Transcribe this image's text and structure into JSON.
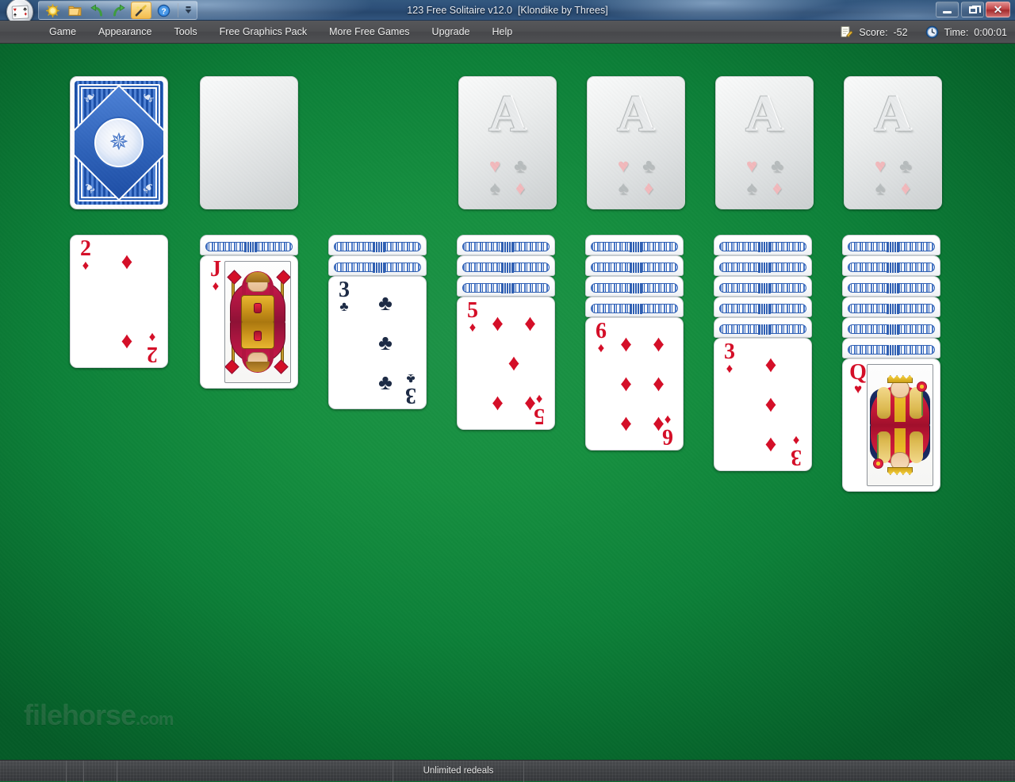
{
  "window": {
    "title": "123 Free Solitaire v12.0  [Klondike by Threes]",
    "minimize_label": "Minimize",
    "maximize_label": "Maximize",
    "close_label": "Close",
    "close_glyph": "✕"
  },
  "app_icon": {
    "name": "app-cards-icon",
    "pips": [
      "♥",
      "♣",
      "♠",
      "♦"
    ]
  },
  "toolbar": {
    "buttons": [
      {
        "name": "new-game-icon",
        "glyph": "☀",
        "label": "New Game",
        "active": false
      },
      {
        "name": "open-game-icon",
        "glyph": "📁",
        "label": "Open Game",
        "active": false
      },
      {
        "name": "undo-icon",
        "glyph": "↶",
        "label": "Undo",
        "active": false
      },
      {
        "name": "redo-icon",
        "glyph": "↷",
        "label": "Redo",
        "active": false
      },
      {
        "name": "hint-wand-icon",
        "glyph": "🪄",
        "label": "Hint",
        "active": true
      },
      {
        "name": "help-icon",
        "glyph": "?",
        "label": "Help",
        "active": false
      }
    ],
    "overflow_glyph": "⏷",
    "overflow_label": "More toolbar commands"
  },
  "menu": {
    "items": [
      "Game",
      "Appearance",
      "Tools",
      "Free Graphics Pack",
      "More Free Games",
      "Upgrade",
      "Help"
    ],
    "score": {
      "icon": "notepad-pencil-icon",
      "label": "Score:  -52",
      "value": -52
    },
    "time": {
      "icon": "clock-icon",
      "label": "Time:  0:00:01",
      "value": "0:00:01"
    }
  },
  "board": {
    "background_color": "#0d8139",
    "stock": {
      "name": "stock-pile",
      "state": "face-down",
      "card_back_style": "blue-ornate-diamond"
    },
    "waste": {
      "name": "waste-pile",
      "state": "empty",
      "label": ""
    },
    "foundations": [
      {
        "name": "foundation-pile-1",
        "placeholder_rank": "A",
        "suits": [
          "♥",
          "♣",
          "♠",
          "♦"
        ]
      },
      {
        "name": "foundation-pile-2",
        "placeholder_rank": "A",
        "suits": [
          "♥",
          "♣",
          "♠",
          "♦"
        ]
      },
      {
        "name": "foundation-pile-3",
        "placeholder_rank": "A",
        "suits": [
          "♥",
          "♣",
          "♠",
          "♦"
        ]
      },
      {
        "name": "foundation-pile-4",
        "placeholder_rank": "A",
        "suits": [
          "♥",
          "♣",
          "♠",
          "♦"
        ]
      }
    ],
    "tableau": [
      {
        "name": "tableau-column-1",
        "facedown": 0,
        "top_card": {
          "rank": "2",
          "suit": "♦",
          "color": "red",
          "art": "pips",
          "pip_count": 2
        }
      },
      {
        "name": "tableau-column-2",
        "facedown": 1,
        "top_card": {
          "rank": "J",
          "suit": "♦",
          "color": "red",
          "art": "jack"
        }
      },
      {
        "name": "tableau-column-3",
        "facedown": 2,
        "top_card": {
          "rank": "3",
          "suit": "♣",
          "color": "black",
          "art": "pips",
          "pip_count": 3
        }
      },
      {
        "name": "tableau-column-4",
        "facedown": 3,
        "top_card": {
          "rank": "5",
          "suit": "♦",
          "color": "red",
          "art": "pips",
          "pip_count": 5
        }
      },
      {
        "name": "tableau-column-5",
        "facedown": 4,
        "top_card": {
          "rank": "6",
          "suit": "♦",
          "color": "red",
          "art": "pips",
          "pip_count": 6
        }
      },
      {
        "name": "tableau-column-6",
        "facedown": 5,
        "top_card": {
          "rank": "3",
          "suit": "♦",
          "color": "red",
          "art": "pips",
          "pip_count": 3
        }
      },
      {
        "name": "tableau-column-7",
        "facedown": 6,
        "top_card": {
          "rank": "Q",
          "suit": "♥",
          "color": "red",
          "art": "queen"
        }
      }
    ]
  },
  "watermark": {
    "text": "filehorse",
    "suffix": ".com"
  },
  "statusbar": {
    "cells": [
      "",
      "",
      "",
      "",
      "Unlimited redeals",
      ""
    ]
  }
}
